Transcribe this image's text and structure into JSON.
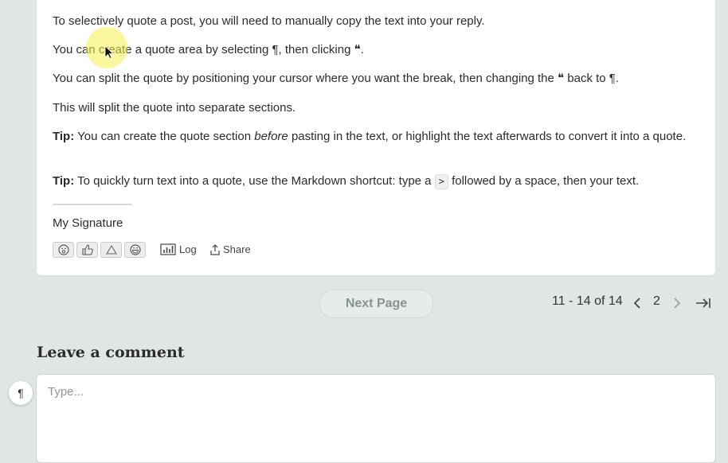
{
  "post": {
    "p1": "To selectively quote a post, you will need to manually copy the text into your reply.",
    "p2": "You can create a quote area by selecting ¶, then clicking ❝.",
    "p3": "You can split the quote by positioning your cursor where you want the break, then changing the ❝ back to ¶.",
    "p4": "This will split the quote into separate sections.",
    "tip1": {
      "label": "Tip:",
      "before": " You can create the quote section ",
      "em": "before",
      "after": " pasting in the text, or highlight the text afterwards to convert it into a quote."
    },
    "tip2": {
      "label": "Tip:",
      "before": " To quickly turn text into a quote, use the Markdown shortcut: type a ",
      "code": ">",
      "after": " followed by a space, then your text."
    },
    "signature": "My Signature",
    "reactions": [
      "wow-icon",
      "thumbs-up-icon",
      "triangle-icon",
      "grin-icon"
    ],
    "actions": {
      "log": "Log",
      "share": "Share"
    }
  },
  "pagination": {
    "next_page": "Next Page",
    "range": "11 - 14 of 14",
    "current_page": "2"
  },
  "comment": {
    "title": "Leave a comment",
    "placeholder": "Type...",
    "format_button": "¶"
  }
}
